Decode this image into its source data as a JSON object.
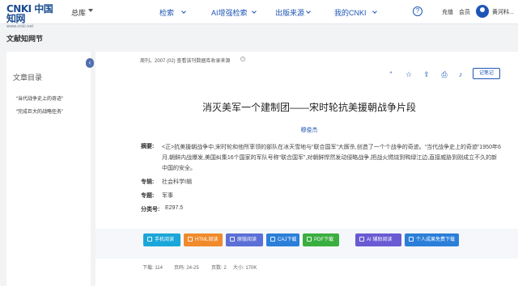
{
  "header": {
    "logo_text": "CNKI 中国知网",
    "logo_sub": "www.cnki.net",
    "library_label": "总库",
    "nav": [
      "检索",
      "AI增强检索",
      "出版来源",
      "我的CNKI"
    ],
    "help_glyph": "?",
    "links": [
      "充值",
      "会员"
    ],
    "username": "黄河科..."
  },
  "page": {
    "section_title": "文献知网节"
  },
  "sidebar": {
    "toggle_glyph": "‹",
    "title": "文章目录",
    "items": [
      "“当代战争史上的奇迹”",
      "“完成巨大的战略任务”"
    ]
  },
  "article": {
    "meta_line": "周刊。2007 (02)  查看该刊数据库收录来源",
    "toolbar_icons": [
      "quote-icon",
      "star-icon",
      "share-icon",
      "print-icon",
      "alert-icon"
    ],
    "toolbar_glyphs": [
      "“",
      "☆",
      "⇪",
      "⎙",
      "♪"
    ],
    "note_button": "记笔记",
    "title": "消灭美军一个建制团——宋时轮抗美援朝战争片段",
    "author": "穆俊杰",
    "abstract_label": "摘要:",
    "abstract": "<正>抗美援朝战争中,宋时轮和他所率领的部队在冰天雪地与“联合国军”大厮杀,创造了一个个战争的奇迹。“当代战争史上的奇迹”1950年6月,朝鲜内战爆发,美国纠集16个国家的军队号称“联合国军”,对朝鲜悍然发动侵略战争,把战火燃烧到鸭绿江边,直接威胁到刚成立不久的新中国的安全。",
    "field_label": "专辑:",
    "field_value": "社会科学Ⅰ辑",
    "subject_label": "专题:",
    "subject_value": "军事",
    "class_label": "分类号:",
    "class_value": "E297.5"
  },
  "downloads": {
    "buttons": [
      {
        "label": "手机阅读",
        "color": "#1aa6d8"
      },
      {
        "label": "HTML阅读",
        "color": "#f08a2c"
      },
      {
        "label": "原版阅读",
        "color": "#5b6fd6"
      },
      {
        "label": "CAJ下载",
        "color": "#2b7fd9"
      },
      {
        "label": "PDF下载",
        "color": "#3aae3f"
      },
      {
        "label": "AI 辅助阅读",
        "color": "#6a5ad3"
      },
      {
        "label": "个人成果免费下载",
        "color": "#2b7fd9"
      }
    ]
  },
  "stats": {
    "downloads_label": "下载:",
    "downloads_value": "114",
    "pages_label": "页码:",
    "pages_value": "24-25",
    "pagecount_label": "页数:",
    "pagecount_value": "2",
    "size_label": "大小:",
    "size_value": "170K"
  }
}
